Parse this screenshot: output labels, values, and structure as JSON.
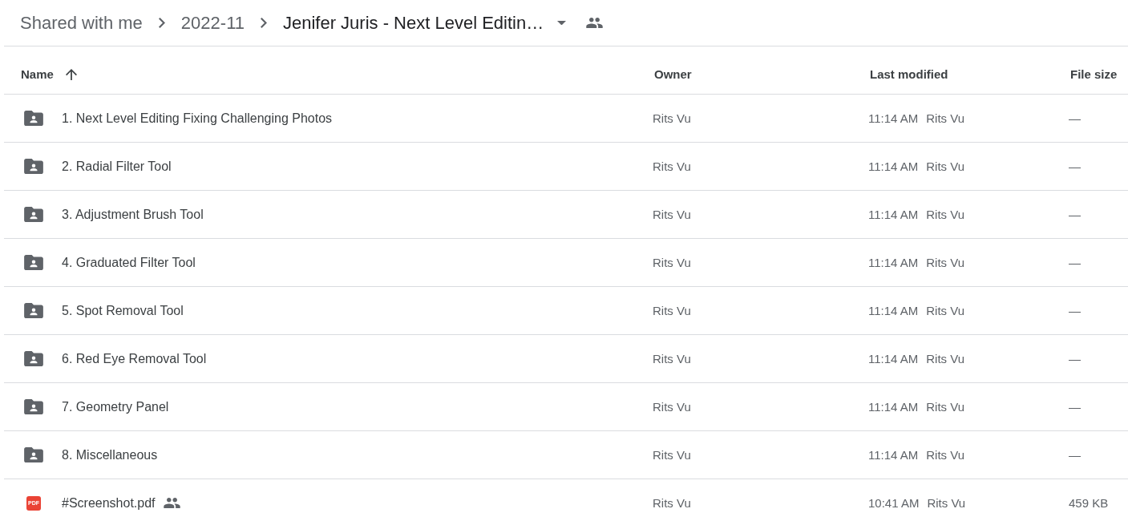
{
  "breadcrumb": [
    {
      "label": "Shared with me",
      "current": false,
      "shared": false
    },
    {
      "label": "2022-11",
      "current": false,
      "shared": false
    },
    {
      "label": "Jenifer Juris - Next Level Editin…",
      "current": true,
      "shared": true
    }
  ],
  "columns": [
    {
      "label": "Name",
      "sorted": true
    },
    {
      "label": "Owner",
      "sorted": false
    },
    {
      "label": "Last modified",
      "sorted": false
    },
    {
      "label": "File size",
      "sorted": false
    }
  ],
  "rows": [
    {
      "kind": "shared_folder",
      "name": "1. Next Level Editing Fixing Challenging Photos",
      "shared": false,
      "owner": "Rits Vu",
      "modified": "11:14 AM",
      "modified_by": "Rits Vu",
      "file_size": "—"
    },
    {
      "kind": "shared_folder",
      "name": "2. Radial Filter Tool",
      "shared": false,
      "owner": "Rits Vu",
      "modified": "11:14 AM",
      "modified_by": "Rits Vu",
      "file_size": "—"
    },
    {
      "kind": "shared_folder",
      "name": "3. Adjustment Brush Tool",
      "shared": false,
      "owner": "Rits Vu",
      "modified": "11:14 AM",
      "modified_by": "Rits Vu",
      "file_size": "—"
    },
    {
      "kind": "shared_folder",
      "name": "4. Graduated Filter Tool",
      "shared": false,
      "owner": "Rits Vu",
      "modified": "11:14 AM",
      "modified_by": "Rits Vu",
      "file_size": "—"
    },
    {
      "kind": "shared_folder",
      "name": "5. Spot Removal Tool",
      "shared": false,
      "owner": "Rits Vu",
      "modified": "11:14 AM",
      "modified_by": "Rits Vu",
      "file_size": "—"
    },
    {
      "kind": "shared_folder",
      "name": "6. Red Eye Removal Tool",
      "shared": false,
      "owner": "Rits Vu",
      "modified": "11:14 AM",
      "modified_by": "Rits Vu",
      "file_size": "—"
    },
    {
      "kind": "shared_folder",
      "name": "7. Geometry Panel",
      "shared": false,
      "owner": "Rits Vu",
      "modified": "11:14 AM",
      "modified_by": "Rits Vu",
      "file_size": "—"
    },
    {
      "kind": "shared_folder",
      "name": "8. Miscellaneous",
      "shared": false,
      "owner": "Rits Vu",
      "modified": "11:14 AM",
      "modified_by": "Rits Vu",
      "file_size": "—"
    },
    {
      "kind": "pdf",
      "type_badge": "PDF",
      "name": "#Screenshot.pdf",
      "shared": true,
      "owner": "Rits Vu",
      "modified": "10:41 AM",
      "modified_by": "Rits Vu",
      "file_size": "459 KB"
    }
  ]
}
